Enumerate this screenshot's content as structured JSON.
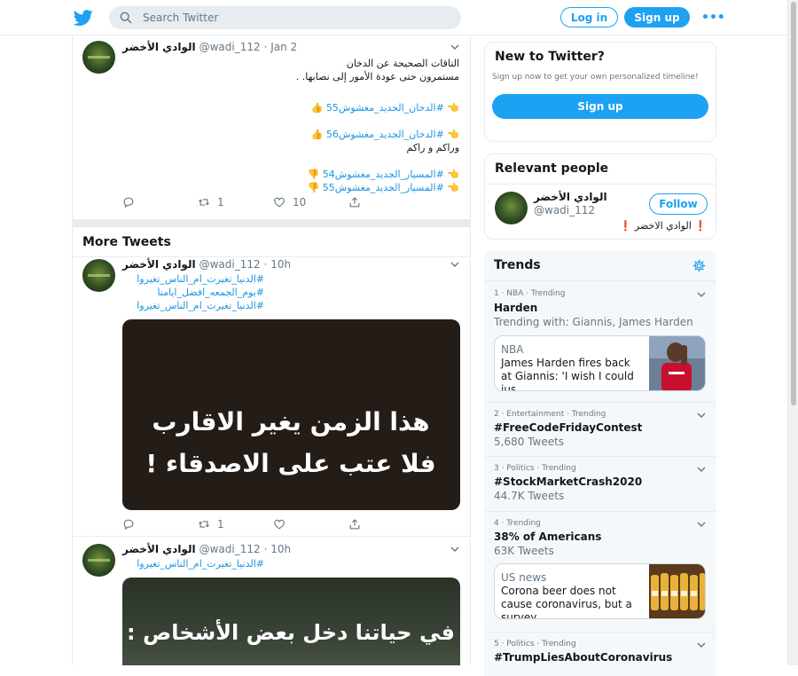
{
  "header": {
    "search_placeholder": "Search Twitter",
    "login_label": "Log in",
    "signup_label": "Sign up",
    "more_label": "•••"
  },
  "tweets": [
    {
      "name": "الوادي الأخضر",
      "handle": "@wadi_112",
      "time": "· Jan 2",
      "lines": [
        "التاقات الصحيحة عن الدخان",
        "مستمرون حتى عودة الأمور إلى نصابها. ."
      ],
      "links": [
        "👈 #الدخان_الجديد_مغشوش55 👍",
        "👈 #الدخان_الجديد_مغشوش56 👍"
      ],
      "extra_line": "وراكم و راكم",
      "links2": [
        "👈 #المسيار_الجديد_مغشوش54 👎",
        "👈 #المسيار_الجديد_مغشوش55 👎"
      ],
      "retweets": "1",
      "likes": "10"
    },
    {
      "name": "الوادي الأخضر",
      "handle": "@wadi_112",
      "time": "· 10h",
      "links": [
        "#الدنيا_تغيرت_ام_الناس_تغيروا",
        "#يوم_الجمعه_افضل_ايامنا",
        "#الدنيا_تغيرت_ام_الناس_تغيروا"
      ],
      "image_text": [
        "هذا الزمن يغير الاقارب",
        "فلا عتب على الاصدقاء !"
      ],
      "retweets": "1",
      "likes": ""
    },
    {
      "name": "الوادي الأخضر",
      "handle": "@wadi_112",
      "time": "· 10h",
      "links": [
        "#الدنيا_تغيرت_ام_الناس_تغيروا"
      ],
      "image_text": [
        "في حياتنا دخل بعض الأشخاص :"
      ]
    }
  ],
  "more_tweets_label": "More Tweets",
  "new_to_twitter": {
    "title": "New to Twitter?",
    "subtitle": "Sign up now to get your own personalized timeline!",
    "button": "Sign up"
  },
  "relevant_people": {
    "title": "Relevant people",
    "name": "الوادي الأخضر",
    "handle": "@wadi_112",
    "follow": "Follow",
    "bio": "الوادي الاخضر",
    "bio_mark": "❗"
  },
  "trends": {
    "title": "Trends",
    "items": [
      {
        "meta": "1 · NBA · Trending",
        "name": "Harden",
        "sub": "Trending with: Giannis, James Harden",
        "news": {
          "category": "NBA",
          "text": "James Harden fires back at Giannis: 'I wish I could jus…"
        }
      },
      {
        "meta": "2 · Entertainment · Trending",
        "name": "#FreeCodeFridayContest",
        "sub": "5,680 Tweets"
      },
      {
        "meta": "3 · Politics · Trending",
        "name": "#StockMarketCrash2020",
        "sub": "44.7K Tweets"
      },
      {
        "meta": "4 · Trending",
        "name": "38% of Americans",
        "sub": "63K Tweets",
        "news": {
          "category": "US news",
          "text": "Corona beer does not cause coronavirus, but a survey …"
        }
      },
      {
        "meta": "5 · Politics · Trending",
        "name": "#TrumpLiesAboutCoronavirus",
        "sub": ""
      }
    ]
  },
  "colors": {
    "accent": "#1da1f2",
    "link": "#1b95e0",
    "text": "#14171a",
    "muted": "#657786",
    "border": "#e6ecf0"
  }
}
